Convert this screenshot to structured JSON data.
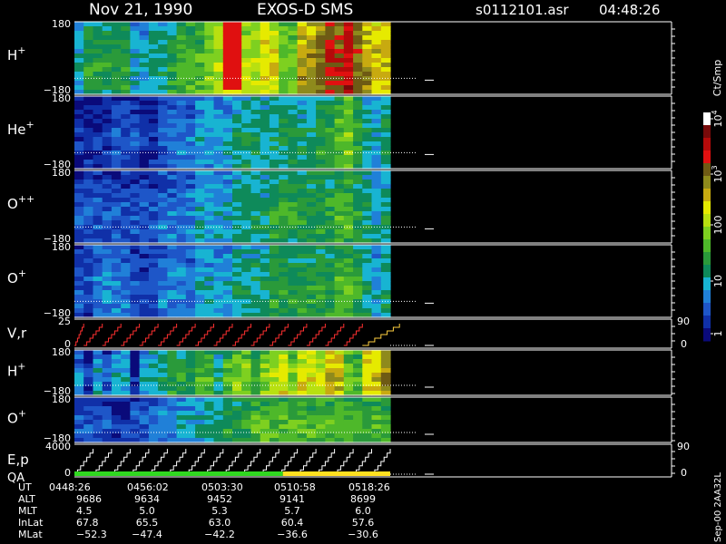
{
  "header": {
    "date": "Nov 21, 1990",
    "mission": "EXOS-D SMS",
    "file": "s0112101.asr",
    "time": "04:48:26"
  },
  "colorbar": {
    "unit": "Ct/Smp",
    "tick_labels": [
      "10",
      "10",
      "100",
      "10",
      "1"
    ],
    "tick_values": [
      10000,
      1000,
      100,
      10,
      1
    ],
    "exponents": [
      "4",
      "3"
    ],
    "colors": [
      "#0a0a7a",
      "#1030a8",
      "#1e56c8",
      "#2080d8",
      "#18b4d2",
      "#0e8a5a",
      "#2a9a3a",
      "#4eb82a",
      "#7ed020",
      "#b8e010",
      "#e6ea00",
      "#c8aa10",
      "#8e8a1c",
      "#6e5a14",
      "#e01010",
      "#b40a0a",
      "#780a0a",
      "#ffffff"
    ]
  },
  "footer_code": "Sep-00  2AA32L",
  "chart_data": [
    {
      "type": "heatmap",
      "label": "H",
      "superscript": "+",
      "ytop": "180",
      "ybot": "−180",
      "ylim": [
        -180,
        180
      ],
      "column_levels": [
        4,
        6,
        6,
        6,
        6,
        6,
        4,
        4,
        5,
        5,
        6,
        7,
        7,
        7,
        8,
        9,
        10,
        10,
        9,
        9,
        10,
        10,
        8,
        8,
        12,
        12,
        13,
        14,
        14,
        15,
        13,
        12,
        11,
        11
      ],
      "notes": "pitch-angle spectrogram; bright horizontal band near 0, red at 05:18 (>10^3)"
    },
    {
      "type": "heatmap",
      "label": "He",
      "superscript": "+",
      "ytop": "180",
      "ybot": "−180",
      "ylim": [
        -180,
        180
      ],
      "column_levels": [
        1,
        1,
        1,
        1,
        2,
        2,
        2,
        1,
        1,
        2,
        3,
        3,
        3,
        4,
        4,
        4,
        4,
        5,
        5,
        5,
        5,
        5,
        5,
        5,
        5,
        5,
        6,
        6,
        7,
        8,
        6,
        5,
        4,
        5
      ]
    },
    {
      "type": "heatmap",
      "label": "O",
      "superscript": "++",
      "ytop": "180",
      "ybot": "−180",
      "ylim": [
        -180,
        180
      ],
      "column_levels": [
        2,
        2,
        2,
        2,
        2,
        2,
        2,
        2,
        2,
        3,
        3,
        3,
        3,
        4,
        4,
        4,
        4,
        5,
        5,
        5,
        5,
        6,
        6,
        6,
        6,
        6,
        6,
        6,
        7,
        7,
        6,
        5,
        4,
        5
      ]
    },
    {
      "type": "heatmap",
      "label": "O",
      "superscript": "+",
      "ytop": "180",
      "ybot": "−180",
      "ylim": [
        -180,
        180
      ],
      "column_levels": [
        2,
        2,
        3,
        3,
        3,
        3,
        2,
        2,
        2,
        3,
        3,
        3,
        3,
        4,
        4,
        4,
        4,
        5,
        5,
        5,
        5,
        6,
        6,
        6,
        6,
        6,
        6,
        6,
        7,
        7,
        6,
        5,
        4,
        5
      ]
    },
    {
      "type": "line",
      "label": "V,r",
      "ytop": "25",
      "ybot": "0",
      "right_top": "90",
      "right_bot": "0",
      "series": [
        {
          "color": "#ff3030",
          "step_groups": [
            [
              0,
              0
            ],
            [
              1,
              2
            ],
            [
              3,
              4
            ],
            [
              5,
              6
            ],
            [
              7,
              8
            ],
            [
              9,
              10
            ],
            [
              11,
              12
            ],
            [
              13,
              14
            ],
            [
              15,
              16
            ],
            [
              17,
              18
            ],
            [
              19,
              20
            ],
            [
              21,
              22
            ],
            [
              23,
              24
            ],
            [
              25,
              26
            ],
            [
              27,
              28
            ],
            [
              29,
              30
            ]
          ]
        },
        {
          "color": "#ffd040",
          "step_groups": [
            [
              31,
              34
            ]
          ]
        }
      ],
      "notes": "sawtooth staircase; red for most of the interval, yellow at end"
    },
    {
      "type": "heatmap",
      "label": "H",
      "superscript": "+",
      "ytop": "180",
      "ybot": "−180",
      "ylim": [
        -180,
        180
      ],
      "column_levels": [
        3,
        1,
        4,
        2,
        4,
        4,
        1,
        4,
        5,
        5,
        6,
        6,
        5,
        7,
        7,
        5,
        7,
        8,
        8,
        6,
        8,
        9,
        10,
        8,
        10,
        10,
        9,
        11,
        11,
        8,
        7,
        11,
        11,
        12
      ],
      "notes": "vertical stripe pattern"
    },
    {
      "type": "heatmap",
      "label": "O",
      "superscript": "+",
      "ytop": "180",
      "ybot": "−180",
      "ylim": [
        -180,
        180
      ],
      "column_levels": [
        2,
        2,
        2,
        2,
        1,
        1,
        2,
        2,
        3,
        3,
        3,
        4,
        4,
        4,
        5,
        5,
        6,
        6,
        6,
        7,
        7,
        7,
        7,
        7,
        7,
        7,
        7,
        7,
        7,
        7,
        7,
        7,
        7,
        7
      ]
    },
    {
      "type": "line",
      "label": "E,p",
      "label2": "QA",
      "ytop": "4000",
      "ybot": "0",
      "right_top": "90",
      "right_bot": "0",
      "series": [
        {
          "color": "#ffffff",
          "step_groups": [
            [
              0,
              1
            ],
            [
              2,
              3
            ],
            [
              4,
              5
            ],
            [
              6,
              7
            ],
            [
              8,
              9
            ],
            [
              10,
              11
            ],
            [
              12,
              13
            ],
            [
              14,
              15
            ],
            [
              16,
              17
            ],
            [
              18,
              19
            ],
            [
              20,
              21
            ],
            [
              22,
              23
            ],
            [
              24,
              25
            ],
            [
              26,
              27
            ],
            [
              28,
              29
            ],
            [
              30,
              31
            ],
            [
              32,
              33
            ]
          ]
        }
      ],
      "qa_bar": [
        {
          "color": "#30d820",
          "from": 0,
          "to": 0.66
        },
        {
          "color": "#ffe020",
          "from": 0.66,
          "to": 1
        }
      ]
    }
  ],
  "ephemeris": {
    "rows": [
      {
        "name": "UT",
        "values": [
          "0448:26",
          "0456:02",
          "0503:30",
          "0510:58",
          "0518:26"
        ]
      },
      {
        "name": "ALT",
        "values": [
          "9686",
          "9634",
          "9452",
          "9141",
          "8699"
        ]
      },
      {
        "name": "MLT",
        "values": [
          "4.5",
          "5.0",
          "5.3",
          "5.7",
          "6.0"
        ]
      },
      {
        "name": "InLat",
        "values": [
          "67.8",
          "65.5",
          "63.0",
          "60.4",
          "57.6"
        ]
      },
      {
        "name": "MLat",
        "values": [
          "−52.3",
          "−47.4",
          "−42.2",
          "−36.6",
          "−30.6"
        ]
      }
    ]
  }
}
